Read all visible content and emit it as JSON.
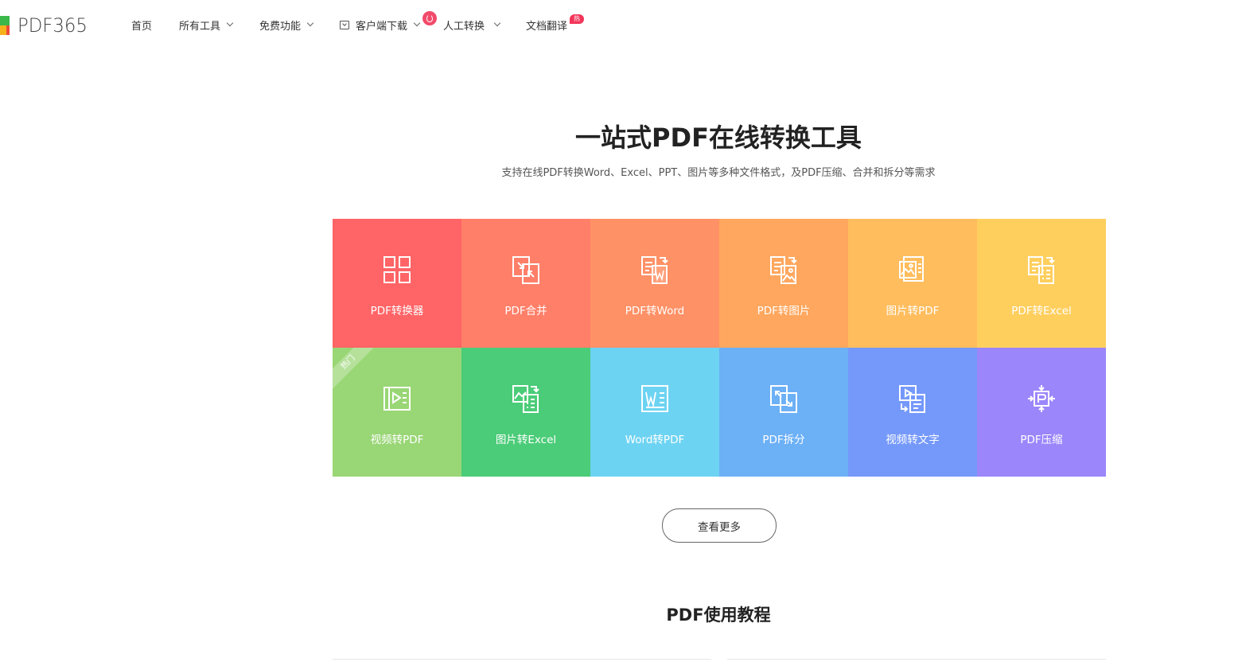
{
  "logo": {
    "text": "PDF365"
  },
  "nav": {
    "home": "首页",
    "all_tools": "所有工具",
    "free_features": "免费功能",
    "client_download": "客户端下载",
    "manual_convert": "人工转换",
    "doc_translate": "文档翻译",
    "hot_badge": "热门"
  },
  "hero": {
    "title": "一站式PDF在线转换工具",
    "subtitle": "支持在线PDF转换Word、Excel、PPT、图片等多种文件格式，及PDF压缩、合并和拆分等需求"
  },
  "tools": [
    {
      "label": "PDF转换器",
      "icon": "grid-icon",
      "color": "#ff6466"
    },
    {
      "label": "PDF合并",
      "icon": "merge-icon",
      "color": "#ff7f69"
    },
    {
      "label": "PDF转Word",
      "icon": "pdf-to-word-icon",
      "color": "#ff9166"
    },
    {
      "label": "PDF转图片",
      "icon": "pdf-to-image-icon",
      "color": "#ffa75e"
    },
    {
      "label": "图片转PDF",
      "icon": "image-to-pdf-icon",
      "color": "#ffbd5e"
    },
    {
      "label": "PDF转Excel",
      "icon": "pdf-to-excel-icon",
      "color": "#ffcf5e"
    },
    {
      "label": "视频转PDF",
      "icon": "video-to-pdf-icon",
      "color": "#99d675",
      "ribbon": "热门"
    },
    {
      "label": "图片转Excel",
      "icon": "image-to-excel-icon",
      "color": "#4bcc78"
    },
    {
      "label": "Word转PDF",
      "icon": "word-to-pdf-icon",
      "color": "#6dd3f2"
    },
    {
      "label": "PDF拆分",
      "icon": "split-icon",
      "color": "#6cb0f6"
    },
    {
      "label": "视频转文字",
      "icon": "video-to-text-icon",
      "color": "#7599fb"
    },
    {
      "label": "PDF压缩",
      "icon": "compress-icon",
      "color": "#9b86fb"
    }
  ],
  "more_button": "查看更多",
  "tutorial_title": "PDF使用教程"
}
